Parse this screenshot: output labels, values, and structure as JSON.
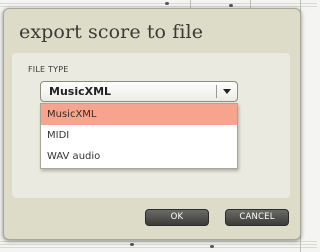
{
  "dialog": {
    "title": "export score to file",
    "file_type_label": "FILE TYPE",
    "select": {
      "value": "MusicXML"
    },
    "options": [
      "MusicXML",
      "MIDI",
      "WAV audio"
    ],
    "selected_option": "MusicXML",
    "ok_label": "OK",
    "cancel_label": "CANCEL"
  },
  "colors": {
    "dialog_bg": "#dddcc9",
    "panel_bg": "#ebeae0",
    "highlight": "#f6a48e",
    "button": "#4a4a46"
  },
  "icons": [
    "chevron-down-icon"
  ]
}
